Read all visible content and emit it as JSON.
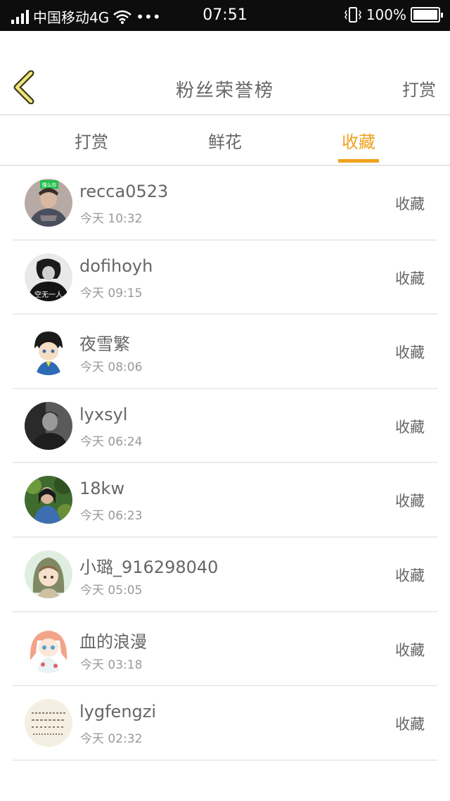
{
  "status": {
    "carrier": "中国移动4G",
    "dots": "•••",
    "time": "07:51",
    "battery": "100%"
  },
  "header": {
    "title": "粉丝荣誉榜",
    "action": "打赏"
  },
  "tabs": [
    {
      "label": "打赏",
      "active": false
    },
    {
      "label": "鲜花",
      "active": false
    },
    {
      "label": "收藏",
      "active": true
    }
  ],
  "colors": {
    "accent": "#f0a01e",
    "text": "#666666",
    "muted": "#999999"
  },
  "rows": [
    {
      "name": "recca0523",
      "time": "今天 10:32",
      "action": "收藏",
      "avatar_text": "懂么你"
    },
    {
      "name": "dofihoyh",
      "time": "今天 09:15",
      "action": "收藏",
      "avatar_text": "空无一人"
    },
    {
      "name": "夜雪繁",
      "time": "今天 08:06",
      "action": "收藏",
      "avatar_text": ""
    },
    {
      "name": "lyxsyl",
      "time": "今天 06:24",
      "action": "收藏",
      "avatar_text": ""
    },
    {
      "name": "18kw",
      "time": "今天 06:23",
      "action": "收藏",
      "avatar_text": ""
    },
    {
      "name": "小璐_916298040",
      "time": "今天 05:05",
      "action": "收藏",
      "avatar_text": ""
    },
    {
      "name": "血的浪漫",
      "time": "今天 03:18",
      "action": "收藏",
      "avatar_text": ""
    },
    {
      "name": "lygfengzi",
      "time": "今天 02:32",
      "action": "收藏",
      "avatar_text": ""
    }
  ]
}
